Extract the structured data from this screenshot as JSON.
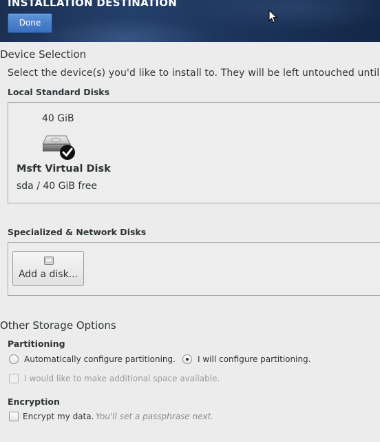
{
  "header": {
    "title": "INSTALLATION DESTINATION",
    "done_label": "Done"
  },
  "device_selection": {
    "title": "Device Selection",
    "description": "Select the device(s) you'd like to install to.  They will be left untouched until y"
  },
  "local_disks": {
    "label": "Local Standard Disks",
    "disks": [
      {
        "size": "40 GiB",
        "name": "Msft Virtual Disk",
        "info": "sda  /  40 GiB free",
        "selected": true
      }
    ]
  },
  "network_disks": {
    "label": "Specialized & Network Disks",
    "add_label": "Add a disk..."
  },
  "other_storage": {
    "title": "Other Storage Options",
    "partitioning": {
      "label": "Partitioning",
      "auto_label": "Automatically configure partitioning.",
      "manual_label": "I will configure partitioning.",
      "selected": "manual",
      "extra_space_label": "I would like to make additional space available.",
      "extra_space_enabled": false
    },
    "encryption": {
      "label": "Encryption",
      "encrypt_label": "Encrypt my data.",
      "hint": "You'll set a passphrase next."
    }
  },
  "colors": {
    "header_bg": "#1d355c",
    "done_button": "#4a80cc",
    "page_bg": "#ececec"
  }
}
